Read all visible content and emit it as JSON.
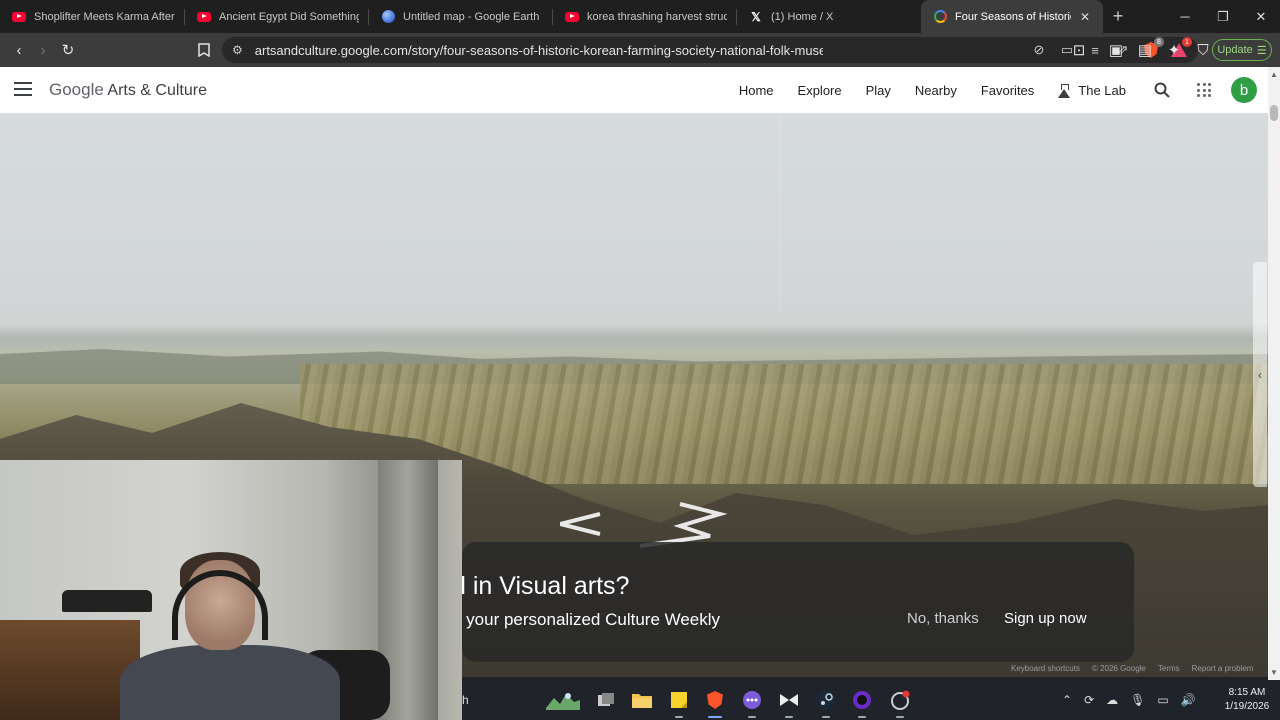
{
  "browser": {
    "tabs": [
      {
        "title": "Shoplifter Meets Karma After Pu",
        "icon": "youtube-icon"
      },
      {
        "title": "Ancient Egypt Did Something W",
        "icon": "youtube-icon"
      },
      {
        "title": "Untitled map - Google Earth",
        "icon": "google-earth-icon"
      },
      {
        "title": "korea thrashing harvest structur",
        "icon": "youtube-icon"
      },
      {
        "title": "(1) Home / X",
        "icon": "x-icon"
      },
      {
        "title": "Four Seasons of Historic Ko",
        "icon": "arts-culture-icon",
        "active": true
      }
    ],
    "new_tab": "+",
    "url": "artsandculture.google.com/story/four-seasons-of-historic-korean-farming-society-national-folk-museum-of...",
    "brave_badge": "8",
    "rewards_badge": "1",
    "update_label": "Update"
  },
  "site": {
    "brand_google": "Google",
    "brand_rest": "Arts & Culture",
    "nav": [
      "Home",
      "Explore",
      "Play",
      "Nearby",
      "Favorites",
      "The Lab"
    ],
    "avatar_letter": "b"
  },
  "promo": {
    "title": "d in Visual arts?",
    "subtitle": "h your personalized Culture Weekly",
    "no_thanks": "No, thanks",
    "sign_up": "Sign up now"
  },
  "footer": {
    "links": [
      "Keyboard shortcuts",
      "© 2026 Google",
      "Terms",
      "Report a problem"
    ]
  },
  "taskbar": {
    "search_fragment": "h",
    "time": "8:15 AM",
    "date": "1/19/2026"
  }
}
